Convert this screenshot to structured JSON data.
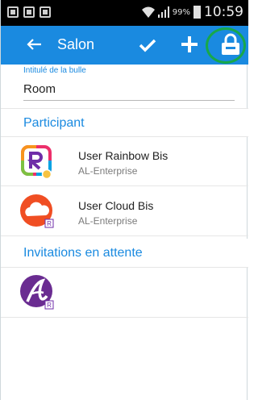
{
  "status_bar": {
    "battery_percent": "99%",
    "time": "10:59"
  },
  "app_bar": {
    "title": "Salon",
    "icons": [
      "back-arrow-icon",
      "check-icon",
      "plus-icon",
      "lock-icon"
    ],
    "accent": "#1a8ae0",
    "highlight_ring_color": "#17a84a"
  },
  "form": {
    "label": "Intitulé de la bulle",
    "value": "Room"
  },
  "sections": {
    "participants_title": "Participant",
    "invitations_title": "Invitations en attente"
  },
  "participants": [
    {
      "name": "User Rainbow Bis",
      "company": "AL-Enterprise",
      "avatar": "rainbow-logo-avatar",
      "presence": "#f6c343"
    },
    {
      "name": "User Cloud Bis",
      "company": "AL-Enterprise",
      "avatar": "cloud-avatar"
    }
  ],
  "invitations": [
    {
      "avatar": "alcatel-logo-avatar"
    }
  ]
}
